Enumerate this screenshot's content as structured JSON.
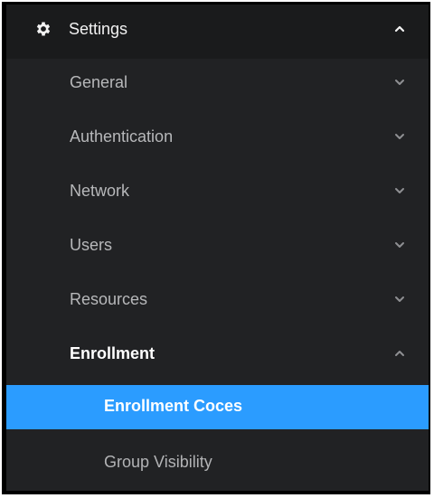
{
  "colors": {
    "panel_bg": "#212224",
    "header_bg": "#1a1b1c",
    "selected_bg": "#2b9cff",
    "text_muted": "#b7b8ba",
    "text_bright": "#ffffff"
  },
  "menu": {
    "section": {
      "label": "Settings",
      "icon": "gear-icon",
      "expanded": true
    },
    "items": [
      {
        "label": "General",
        "expanded": false
      },
      {
        "label": "Authentication",
        "expanded": false
      },
      {
        "label": "Network",
        "expanded": false
      },
      {
        "label": "Users",
        "expanded": false
      },
      {
        "label": "Resources",
        "expanded": false
      },
      {
        "label": "Enrollment",
        "expanded": true,
        "children": [
          {
            "label": "Enrollment Coces",
            "selected": true
          },
          {
            "label": "Group Visibility",
            "selected": false
          }
        ]
      }
    ]
  }
}
